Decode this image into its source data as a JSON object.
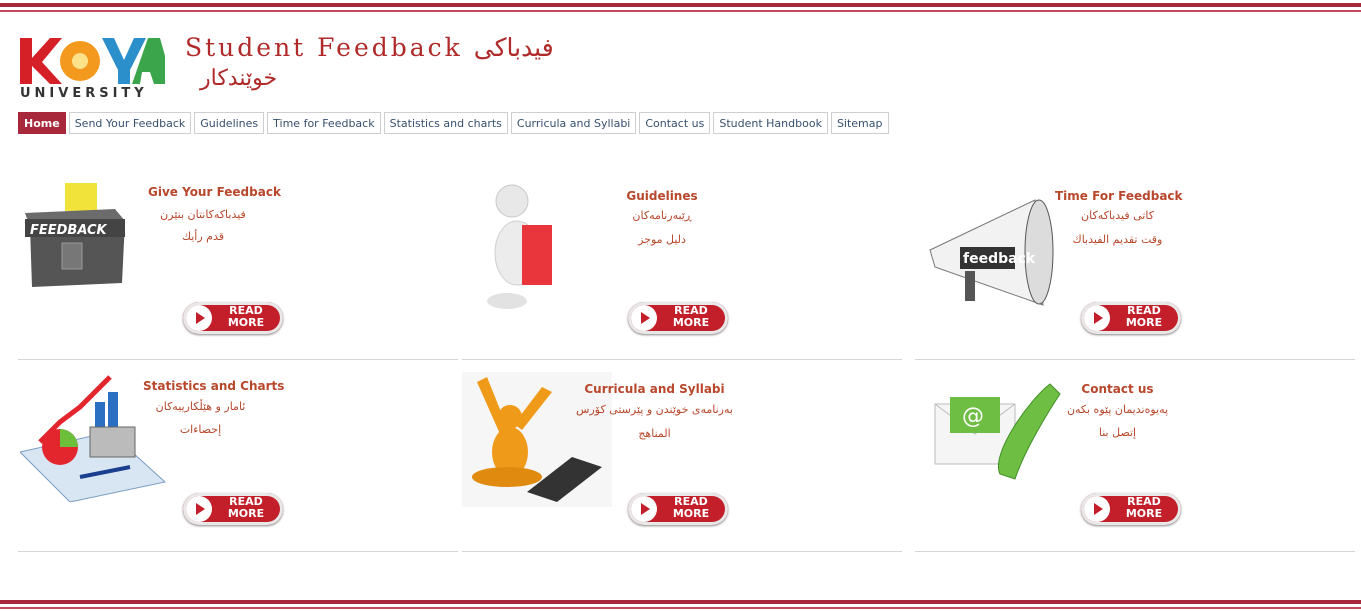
{
  "header": {
    "logo_text": "UNIVERSITY",
    "title_line1": "Student Feedback فیدباکی",
    "title_line2": "خوێندکار"
  },
  "nav": {
    "tabs": [
      {
        "label": "Home",
        "active": true
      },
      {
        "label": "Send Your Feedback",
        "active": false
      },
      {
        "label": "Guidelines",
        "active": false
      },
      {
        "label": "Time for Feedback",
        "active": false
      },
      {
        "label": "Statistics and charts",
        "active": false
      },
      {
        "label": "Curricula and Syllabi",
        "active": false
      },
      {
        "label": "Contact us",
        "active": false
      },
      {
        "label": "Student Handbook",
        "active": false
      },
      {
        "label": "Sitemap",
        "active": false
      }
    ]
  },
  "cards": [
    {
      "title": "Give Your Feedback",
      "line1": "فیدباکەکانتان بنێرن",
      "line2": "قدم رأيك",
      "button": "READ MORE",
      "icon": "feedback-box-icon"
    },
    {
      "title": "Guidelines",
      "line1": "ڕێبەرنامەکان",
      "line2": "دليل موجز",
      "button": "READ MORE",
      "icon": "person-with-sign-icon"
    },
    {
      "title": "Time For Feedback",
      "line1": "کاتی فیدباکەکان",
      "line2": "وقت تقديم الفيدباك",
      "button": "READ MORE",
      "icon": "megaphone-icon"
    },
    {
      "title": "Statistics and Charts",
      "line1": "ئامار و هێڵکارییەکان",
      "line2": "إحصاءات",
      "button": "READ MORE",
      "icon": "charts-calculator-icon"
    },
    {
      "title": "Curricula and Syllabi",
      "line1": "بەرنامەی خوێندن و پێرستی کۆرس",
      "line2": "المناهج",
      "button": "READ MORE",
      "icon": "person-laptop-icon"
    },
    {
      "title": "Contact us",
      "line1": "پەیوەندیمان پێوە بکەن",
      "line2": "إتصل بنا",
      "button": "READ MORE",
      "icon": "envelope-phone-icon"
    }
  ],
  "colors": {
    "brand": "#a7283a",
    "title": "#b8472b",
    "nav_text": "#36506e",
    "button": "#c21f2a"
  }
}
